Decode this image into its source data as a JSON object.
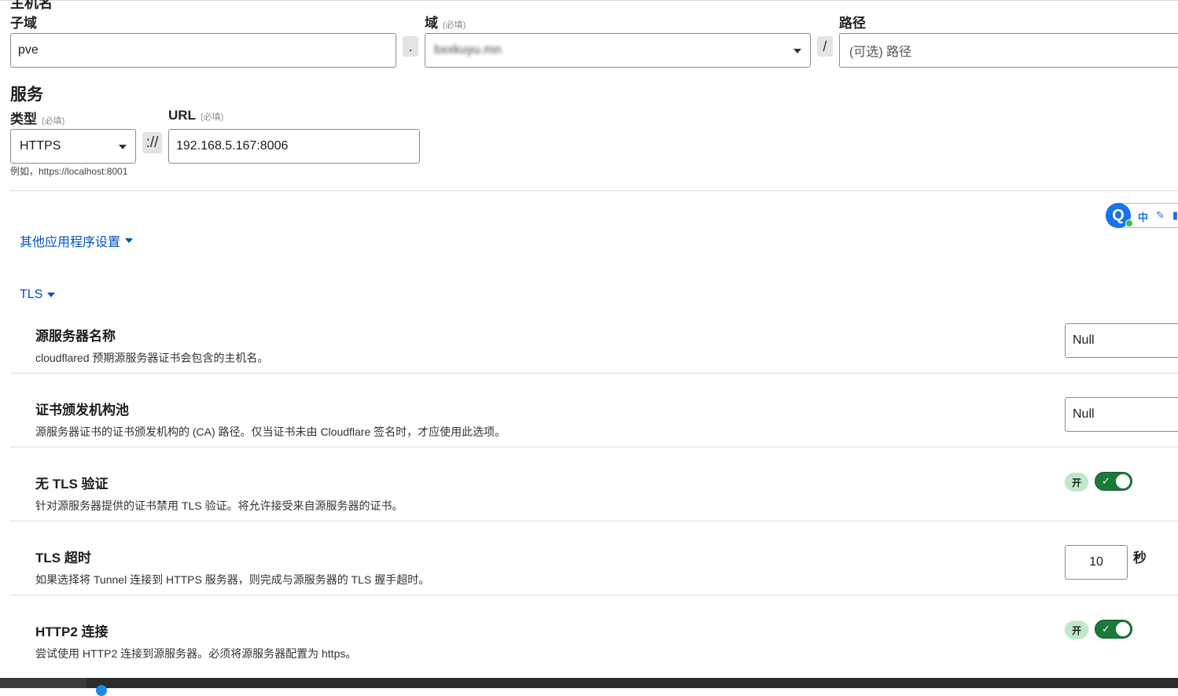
{
  "header_partial_title": "主机名",
  "hostname": {
    "subdomain_label": "子域",
    "subdomain_value": "pve",
    "dot_sep": ".",
    "domain_label": "域",
    "domain_required": "(必填)",
    "domain_value": "bxxkuyu.mn",
    "slash_sep": "/",
    "path_label": "路径",
    "path_placeholder": "(可选) 路径"
  },
  "service": {
    "section_title": "服务",
    "type_label": "类型",
    "type_required": "(必填)",
    "type_value": "HTTPS",
    "scheme_sep": "://",
    "url_label": "URL",
    "url_required": "(必填)",
    "url_value": "192.168.5.167:8006",
    "example_hint": "例如，https://localhost:8001"
  },
  "other_settings_link": "其他应用程序设置",
  "tls_link": "TLS",
  "tls_rows": [
    {
      "title": "源服务器名称",
      "desc": "cloudflared 预期源服务器证书会包含的主机名。",
      "control": "Null"
    },
    {
      "title": "证书颁发机构池",
      "desc": "源服务器证书的证书颁发机构的 (CA) 路径。仅当证书未由 Cloudflare 签名时，才应使用此选项。",
      "control": "Null"
    },
    {
      "title": "无 TLS 验证",
      "desc": "针对源服务器提供的证书禁用 TLS 验证。将允许接受来自源服务器的证书。",
      "on_label": "开",
      "toggled": true
    },
    {
      "title": "TLS 超时",
      "desc": "如果选择将 Tunnel 连接到 HTTPS 服务器，则完成与源服务器的 TLS 握手超时。",
      "value": "10",
      "unit": "秒"
    },
    {
      "title": "HTTP2 连接",
      "desc": "尝试使用 HTTP2 连接到源服务器。必须将源服务器配置为 https。",
      "on_label": "开",
      "toggled": true
    }
  ],
  "ime_toolbar": {
    "logo": "Q",
    "mode": "中",
    "edit_icon": "pencil-icon",
    "more_icon": "shirt-icon"
  },
  "colors": {
    "link": "#0051c3",
    "toggle_on": "#1b7a3a",
    "on_badge": "#bfe8c8",
    "ime": "#1a73e8"
  }
}
